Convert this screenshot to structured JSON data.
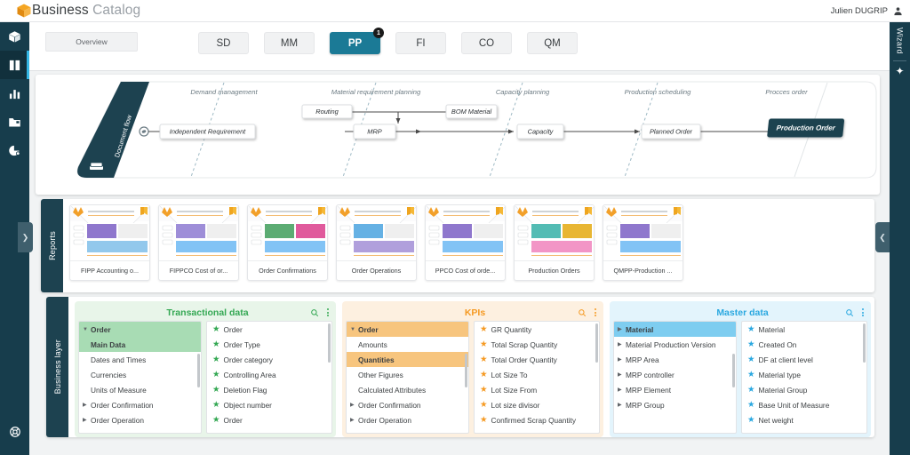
{
  "header": {
    "brand_bold": "Business",
    "brand_light": "Catalog",
    "logo_icon": "cube-icon",
    "user_name": "Julien DUGRIP",
    "user_icon": "user-avatar-icon"
  },
  "rail": {
    "items": [
      {
        "icon": "cube-icon",
        "name": "catalog-cube",
        "active": false
      },
      {
        "icon": "book-icon",
        "name": "business-catalog",
        "active": true
      },
      {
        "icon": "bar-chart-icon",
        "name": "analytics",
        "active": false
      },
      {
        "icon": "folder-icon",
        "name": "repository",
        "active": false
      },
      {
        "icon": "pie-chart-icon",
        "name": "reports",
        "active": false
      }
    ],
    "bottom_icon": "lifebuoy-help-icon",
    "collapse_left_icon": "chevron-right-icon",
    "collapse_right_icon": "chevron-left-icon"
  },
  "wizard": {
    "label": "Wizard",
    "icon": "sparkles-icon"
  },
  "tabbar": {
    "overview_label": "Overview",
    "tabs": [
      {
        "label": "SD",
        "active": false,
        "badge": ""
      },
      {
        "label": "MM",
        "active": false,
        "badge": ""
      },
      {
        "label": "PP",
        "active": true,
        "badge": "1"
      },
      {
        "label": "FI",
        "active": false,
        "badge": ""
      },
      {
        "label": "CO",
        "active": false,
        "badge": ""
      },
      {
        "label": "QM",
        "active": false,
        "badge": ""
      }
    ],
    "active_color": "#1b7a96"
  },
  "diagram": {
    "side_label": "Document flow",
    "side_icon": "book-stack-icon",
    "start_icon": "start-node-icon",
    "end_icon": "end-node-icon",
    "lanes": [
      "Demand management",
      "Material requirement planning",
      "Capacity planning",
      "Production scheduling",
      "Procces order"
    ],
    "nodes": [
      {
        "label": "Independent Requirement",
        "highlight": false
      },
      {
        "label": "Routing",
        "highlight": false
      },
      {
        "label": "BOM Material",
        "highlight": false
      },
      {
        "label": "MRP",
        "highlight": false
      },
      {
        "label": "Capacity",
        "highlight": false
      },
      {
        "label": "Planned Order",
        "highlight": false
      },
      {
        "label": "Production Order",
        "highlight": true
      }
    ],
    "highlight_color": "#1d4250"
  },
  "reports": {
    "side_label": "Reports",
    "items": [
      {
        "title": "FIPP Accounting o...",
        "icon": "powerbi-icon"
      },
      {
        "title": "FIPPCO Cost of or...",
        "icon": "powerbi-icon"
      },
      {
        "title": "Order Confirmations",
        "icon": "powerbi-icon"
      },
      {
        "title": "Order Operations",
        "icon": "powerbi-icon"
      },
      {
        "title": "PPCO Cost of orde...",
        "icon": "powerbi-icon"
      },
      {
        "title": "Production Orders",
        "icon": "powerbi-icon"
      },
      {
        "title": "QMPP-Production ...",
        "icon": "powerbi-icon"
      }
    ]
  },
  "business_layer": {
    "side_label": "Business layer",
    "panels": [
      {
        "title": "Transactional data",
        "accent": "#34a853",
        "accent_light": "#e8f5e9",
        "accent_mid": "#a8dcb4",
        "search_icon": "search-icon",
        "menu_icon": "more-vertical-icon",
        "tree": [
          {
            "label": "Order",
            "level": 0,
            "expanded": true,
            "selected": false,
            "bold": true
          },
          {
            "label": "Main Data",
            "level": 1,
            "expanded": null,
            "selected": true,
            "bold": true
          },
          {
            "label": "Dates and Times",
            "level": 1,
            "expanded": null,
            "selected": false,
            "bold": false
          },
          {
            "label": "Currencies",
            "level": 1,
            "expanded": null,
            "selected": false,
            "bold": false
          },
          {
            "label": "Units of Measure",
            "level": 1,
            "expanded": null,
            "selected": false,
            "bold": false
          },
          {
            "label": "Order Confirmation",
            "level": 0,
            "expanded": false,
            "selected": false,
            "bold": false
          },
          {
            "label": "Order Operation",
            "level": 0,
            "expanded": false,
            "selected": false,
            "bold": false
          }
        ],
        "fields": [
          "Order",
          "Order Type",
          "Order category",
          "Controlling Area",
          "Deletion Flag",
          "Object number",
          "Order"
        ]
      },
      {
        "title": "KPIs",
        "accent": "#f59a23",
        "accent_light": "#fdf0e0",
        "accent_mid": "#f7c57e",
        "search_icon": "search-icon",
        "menu_icon": "more-vertical-icon",
        "tree": [
          {
            "label": "Order",
            "level": 0,
            "expanded": true,
            "selected": false,
            "bold": true
          },
          {
            "label": "Amounts",
            "level": 1,
            "expanded": null,
            "selected": false,
            "bold": false
          },
          {
            "label": "Quantities",
            "level": 1,
            "expanded": null,
            "selected": true,
            "bold": true
          },
          {
            "label": "Other Figures",
            "level": 1,
            "expanded": null,
            "selected": false,
            "bold": false
          },
          {
            "label": "Calculated Attributes",
            "level": 1,
            "expanded": null,
            "selected": false,
            "bold": false
          },
          {
            "label": "Order Confirmation",
            "level": 0,
            "expanded": false,
            "selected": false,
            "bold": false
          },
          {
            "label": "Order Operation",
            "level": 0,
            "expanded": false,
            "selected": false,
            "bold": false
          }
        ],
        "fields": [
          "GR Quantity",
          "Total Scrap Quantity",
          "Total Order Quantity",
          "Lot Size To",
          "Lot Size From",
          "Lot size divisor",
          "Confirmed Scrap Quantity"
        ]
      },
      {
        "title": "Master data",
        "accent": "#2aa8e0",
        "accent_light": "#e3f4fc",
        "accent_mid": "#7ecdf0",
        "search_icon": "search-icon",
        "menu_icon": "more-vertical-icon",
        "tree": [
          {
            "label": "Material",
            "level": 0,
            "expanded": null,
            "selected": true,
            "bold": true
          },
          {
            "label": "Material Production Version",
            "level": 0,
            "expanded": null,
            "selected": false,
            "bold": false
          },
          {
            "label": "MRP Area",
            "level": 0,
            "expanded": null,
            "selected": false,
            "bold": false
          },
          {
            "label": "MRP controller",
            "level": 0,
            "expanded": null,
            "selected": false,
            "bold": false
          },
          {
            "label": "MRP Element",
            "level": 0,
            "expanded": null,
            "selected": false,
            "bold": false
          },
          {
            "label": "MRP Group",
            "level": 0,
            "expanded": null,
            "selected": false,
            "bold": false
          }
        ],
        "fields": [
          "Material",
          "Created On",
          "DF at client level",
          "Material type",
          "Material Group",
          "Base Unit of Measure",
          "Net weight"
        ]
      }
    ]
  }
}
